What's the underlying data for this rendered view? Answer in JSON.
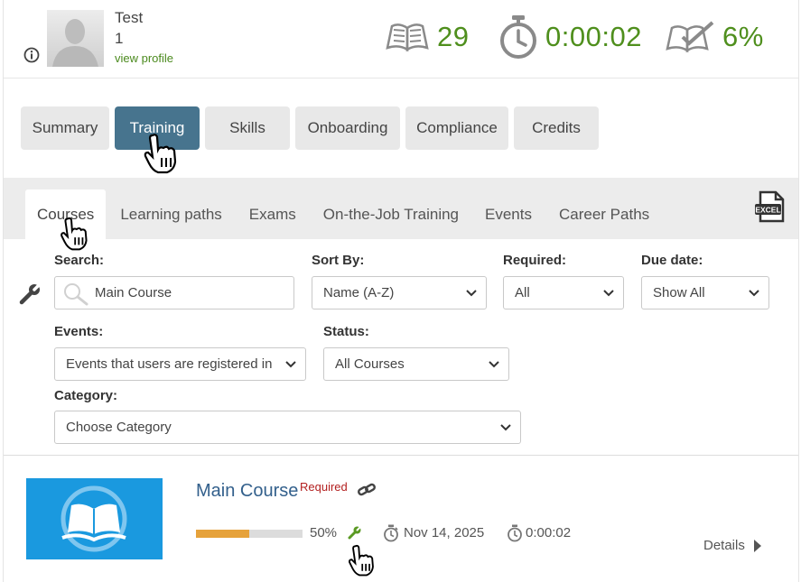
{
  "user": {
    "name": "Test",
    "id": "1",
    "view_profile": "view profile"
  },
  "stats": {
    "courses": "29",
    "time": "0:00:02",
    "completion": "6%"
  },
  "main_tabs": [
    {
      "label": "Summary",
      "active": false
    },
    {
      "label": "Training",
      "active": true
    },
    {
      "label": "Skills",
      "active": false
    },
    {
      "label": "Onboarding",
      "active": false
    },
    {
      "label": "Compliance",
      "active": false
    },
    {
      "label": "Credits",
      "active": false
    }
  ],
  "sub_tabs": [
    {
      "label": "Courses",
      "active": true
    },
    {
      "label": "Learning paths",
      "active": false
    },
    {
      "label": "Exams",
      "active": false
    },
    {
      "label": "On-the-Job Training",
      "active": false
    },
    {
      "label": "Events",
      "active": false
    },
    {
      "label": "Career Paths",
      "active": false
    }
  ],
  "excel_label": "EXCEL",
  "filters": {
    "search_label": "Search:",
    "search_value": "Main Course",
    "sort_label": "Sort By:",
    "sort_value": "Name (A-Z)",
    "required_label": "Required:",
    "required_value": "All",
    "due_label": "Due date:",
    "due_value": "Show All",
    "events_label": "Events:",
    "events_value": "Events that users are registered in",
    "status_label": "Status:",
    "status_value": "All Courses",
    "category_label": "Category:",
    "category_value": "Choose Category"
  },
  "course": {
    "title": "Main Course",
    "required": "Required",
    "progress": 50,
    "progress_label": "50%",
    "due_date": "Nov 14, 2025",
    "time": "0:00:02",
    "details": "Details"
  },
  "colors": {
    "accent_green": "#4f8f1d",
    "active_tab": "#47748e",
    "thumb_blue": "#1a99df",
    "progress": "#e6a23b"
  }
}
